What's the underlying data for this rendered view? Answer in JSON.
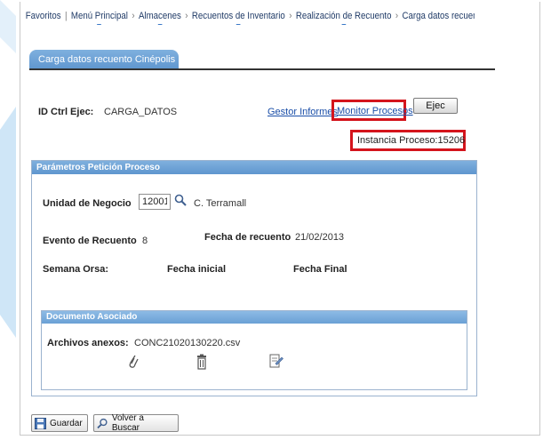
{
  "breadcrumb": [
    {
      "label": "Favoritos",
      "drop": false
    },
    {
      "label": "Menú Principal",
      "drop": true
    },
    {
      "label": "Almacenes",
      "drop": true
    },
    {
      "label": "Recuentos de Inventario",
      "drop": true
    },
    {
      "label": "Realización de Recuento",
      "drop": true
    },
    {
      "label": "Carga datos recuento Cinépolis",
      "drop": false
    }
  ],
  "tab": {
    "label": "Carga datos recuento Cinépolis"
  },
  "run_control": {
    "label": "ID Ctrl Ejec:",
    "value": "CARGA_DATOS",
    "gestor_link": "Gestor Informes",
    "monitor_link": "Monitor Procesos",
    "ejec_button": "Ejec",
    "instancia": "Instancia Proceso:15206"
  },
  "params": {
    "title": "Parámetros Petición Proceso",
    "unidad_label": "Unidad de Negocio",
    "unidad_value": "12001",
    "unidad_desc": "C. Terramall",
    "evento_label": "Evento de Recuento",
    "evento_value": "8",
    "fecha_label": "Fecha de recuento",
    "fecha_value": "21/02/2013",
    "semana_label": "Semana Orsa:",
    "fecha_inicial_label": "Fecha inicial",
    "fecha_final_label": "Fecha Final"
  },
  "documento": {
    "title": "Documento Asociado",
    "archivos_label": "Archivos anexos:",
    "file_name": "CONC21020130220.csv"
  },
  "buttons": {
    "guardar": "Guardar",
    "volver": "Volver a Buscar"
  },
  "colors": {
    "accent": "#5f96cf",
    "highlight": "#d4141c",
    "link": "#1a4ea8"
  }
}
